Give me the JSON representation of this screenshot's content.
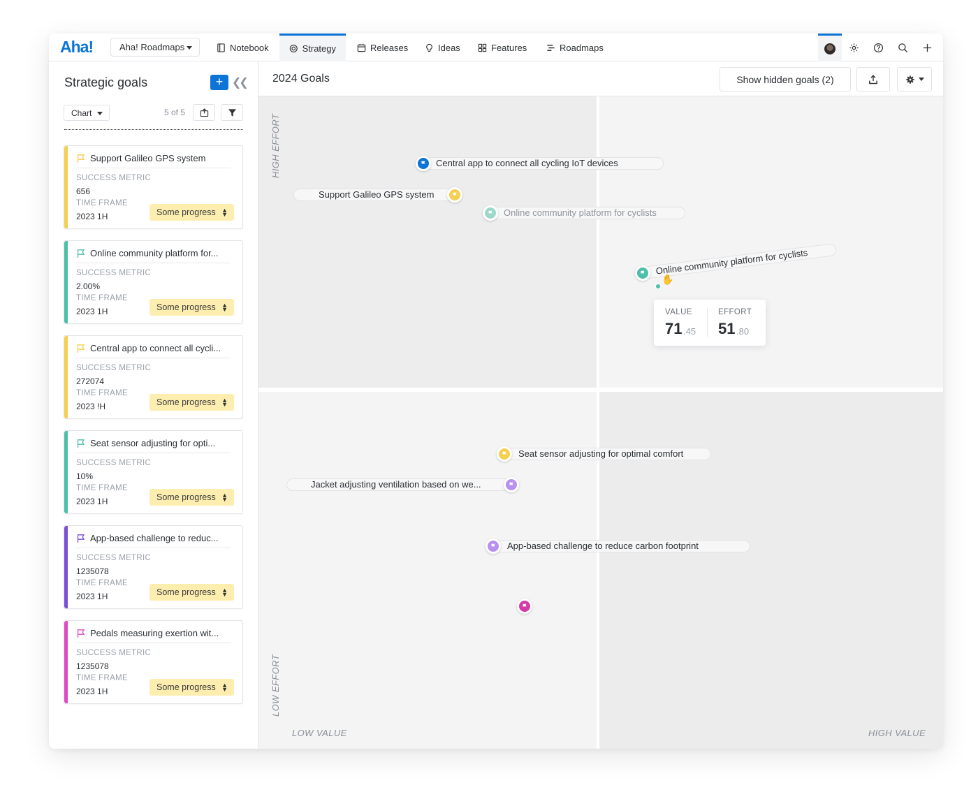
{
  "app": {
    "logo": "Aha!",
    "workspace": "Aha! Roadmaps",
    "tabs": [
      {
        "label": "Notebook",
        "icon": "notebook-icon"
      },
      {
        "label": "Strategy",
        "icon": "target-icon",
        "active": true
      },
      {
        "label": "Releases",
        "icon": "calendar-icon"
      },
      {
        "label": "Ideas",
        "icon": "lightbulb-icon"
      },
      {
        "label": "Features",
        "icon": "grid-icon"
      },
      {
        "label": "Roadmaps",
        "icon": "roadmap-icon"
      }
    ],
    "accent": "#0b74d6"
  },
  "sidebar": {
    "title": "Strategic goals",
    "view": "Chart",
    "count": "5 of 5",
    "metric_label": "SUCCESS METRIC",
    "timeframe_label": "TIME FRAME",
    "goals": [
      {
        "name": "Support Galileo GPS system",
        "metric": "656",
        "timeframe": "2023 1H",
        "status": "Some progress",
        "color": "#f5cf4f"
      },
      {
        "name": "Online community platform for...",
        "metric": "2.00%",
        "timeframe": "2023 1H",
        "status": "Some progress",
        "color": "#4dbfa8"
      },
      {
        "name": "Central app to connect all cycli...",
        "metric": "272074",
        "timeframe": "2023 !H",
        "status": "Some progress",
        "color": "#f5cf4f"
      },
      {
        "name": "Seat sensor adjusting for opti...",
        "metric": "10%",
        "timeframe": "2023 1H",
        "status": "Some progress",
        "color": "#4dbfa8"
      },
      {
        "name": "App-based challenge to reduc...",
        "metric": "1235078",
        "timeframe": "2023 1H",
        "status": "Some progress",
        "color": "#7b4fd6"
      },
      {
        "name": "Pedals measuring exertion wit...",
        "metric": "1235078",
        "timeframe": "2023 1H",
        "status": "Some progress",
        "color": "#e04bc3"
      }
    ]
  },
  "main": {
    "title": "2024 Goals",
    "hidden_button": "Show hidden goals (2)"
  },
  "chart": {
    "y_high": "HIGH EFFORT",
    "y_low": "LOW EFFORT",
    "x_low": "LOW VALUE",
    "x_high": "HIGH VALUE",
    "points": [
      {
        "label": "Central app to connect all cycling IoT devices",
        "color": "#0b74d6"
      },
      {
        "label": "Support Galileo GPS system",
        "color": "#f5cf4f"
      },
      {
        "label": "Online community platform for cyclists",
        "color": "#9dd9cb"
      },
      {
        "label": "Online community platform for cyclists",
        "color": "#4dbfa8"
      },
      {
        "label": "Seat sensor adjusting for optimal comfort",
        "color": "#f5cf4f"
      },
      {
        "label": "Jacket adjusting ventilation based on we...",
        "color": "#b891ef"
      },
      {
        "label": "App-based challenge to reduce carbon footprint",
        "color": "#b891ef"
      },
      {
        "label": "",
        "color": "#d63aa8"
      }
    ],
    "tooltip": {
      "value_label": "VALUE",
      "value_int": "71",
      "value_dec": ".45",
      "effort_label": "EFFORT",
      "effort_int": "51",
      "effort_dec": ".80"
    }
  }
}
